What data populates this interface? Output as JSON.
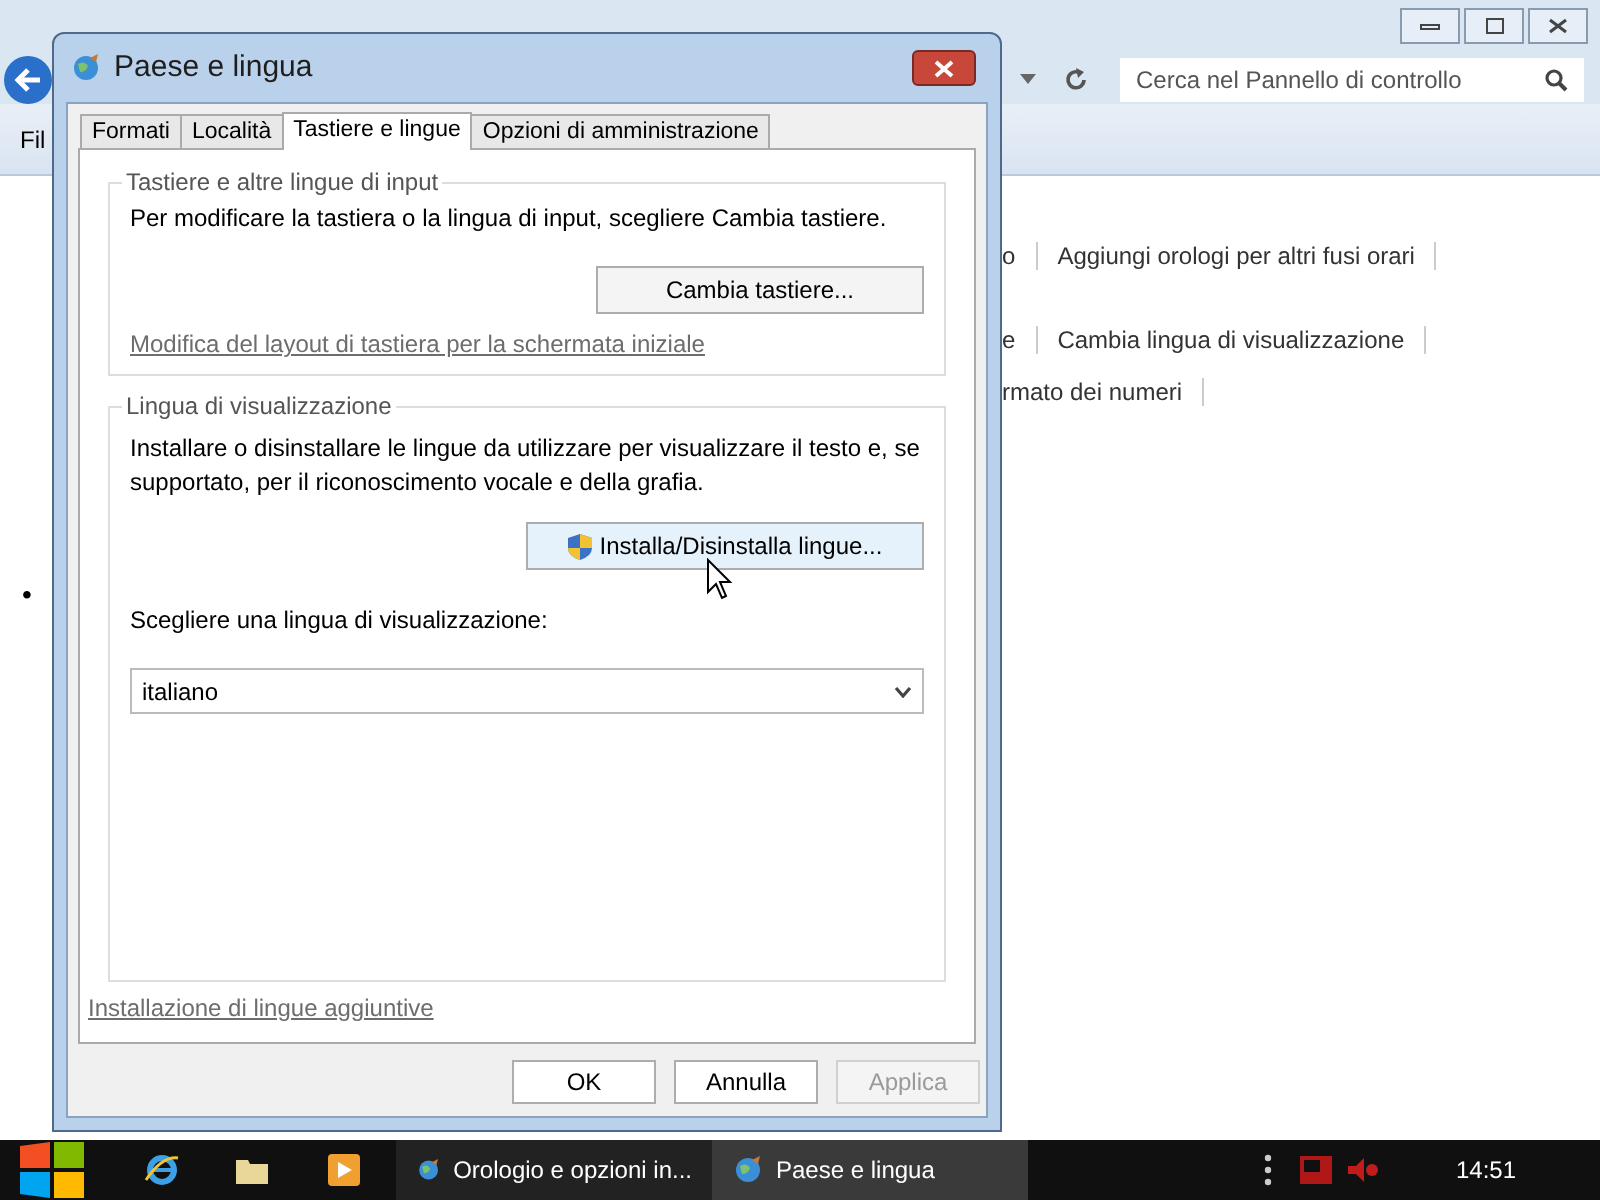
{
  "background_window": {
    "menu": [
      "Fil"
    ],
    "search": {
      "placeholder": "Cerca nel Pannello di controllo"
    },
    "link_rows": [
      [
        "o",
        "Aggiungi orologi per altri fusi orari"
      ],
      [
        "e",
        "Cambia lingua di visualizzazione"
      ],
      [
        "rmato dei numeri"
      ]
    ],
    "bullet": "•"
  },
  "dialog": {
    "title": "Paese e lingua",
    "tabs": [
      {
        "label": "Formati",
        "selected": false
      },
      {
        "label": "Località",
        "selected": false
      },
      {
        "label": "Tastiere e lingue",
        "selected": true
      },
      {
        "label": "Opzioni di amministrazione",
        "selected": false
      }
    ],
    "keyboards_group": {
      "legend": "Tastiere e altre lingue di input",
      "text": "Per modificare la tastiera o la lingua di input, scegliere Cambia tastiere.",
      "button": "Cambia tastiere...",
      "link": "Modifica del layout di tastiera per la schermata iniziale"
    },
    "display_group": {
      "legend": "Lingua di visualizzazione",
      "text": "Installare o disinstallare le lingue da utilizzare per visualizzare il testo e, se supportato, per il riconoscimento vocale e della grafia.",
      "button": "Installa/Disinstalla lingue...",
      "select_label": "Scegliere una lingua di visualizzazione:",
      "select_value": "italiano"
    },
    "link": "Installazione di lingue aggiuntive",
    "buttons": [
      {
        "label": "OK",
        "disabled": false
      },
      {
        "label": "Annulla",
        "disabled": false
      },
      {
        "label": "Applica",
        "disabled": true
      }
    ]
  },
  "taskbar": {
    "tasks": [
      {
        "label": "Orologio e opzioni in...",
        "selected": false
      },
      {
        "label": "Paese e lingua",
        "selected": true
      }
    ],
    "clock": "14:51"
  }
}
